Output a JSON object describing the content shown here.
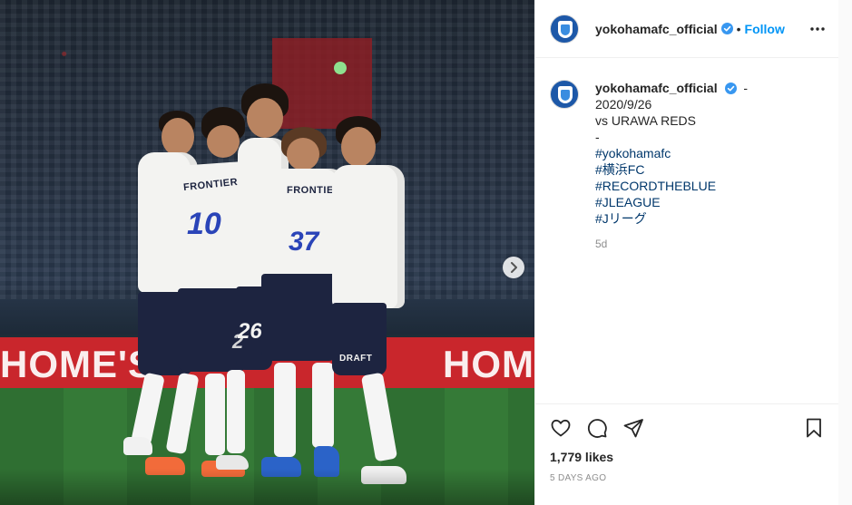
{
  "post": {
    "account": {
      "username": "yokohamafc_official",
      "verified": true,
      "avatar_icon": "yokohamafc-crest-icon"
    },
    "header": {
      "separator": "•",
      "follow_label": "Follow",
      "more_icon": "more-horizontal-icon"
    },
    "caption": {
      "author": "yokohamafc_official",
      "trail": "-",
      "lines": [
        "2020/9/26",
        "vs URAWA REDS",
        "-"
      ],
      "hashtags": [
        "#yokohamafc",
        "#横浜FC",
        "#RECORDTHEBLUE",
        "#JLEAGUE",
        "#Jリーグ"
      ],
      "age": "5d"
    },
    "actions": {
      "like_icon": "heart-icon",
      "comment_icon": "comment-icon",
      "share_icon": "share-icon",
      "save_icon": "bookmark-icon"
    },
    "likes_label": "1,779 likes",
    "time_ago": "5 DAYS AGO"
  },
  "photo": {
    "description_icon": "team-celebration-photo",
    "board_texts": [
      "HOME'S",
      "HOM"
    ],
    "jersey_numbers": [
      "10",
      "37",
      "26",
      "2"
    ],
    "sponsor_texts": [
      "FRONTIER",
      "FRONTIER",
      "DRAFT"
    ],
    "next_icon": "chevron-right-icon"
  },
  "colors": {
    "link": "#00376b",
    "follow": "#0095f6",
    "verified": "#3897f0",
    "muted": "#8e8e8e",
    "kit_blue": "#2a44b8",
    "board_red": "#c9262c"
  }
}
